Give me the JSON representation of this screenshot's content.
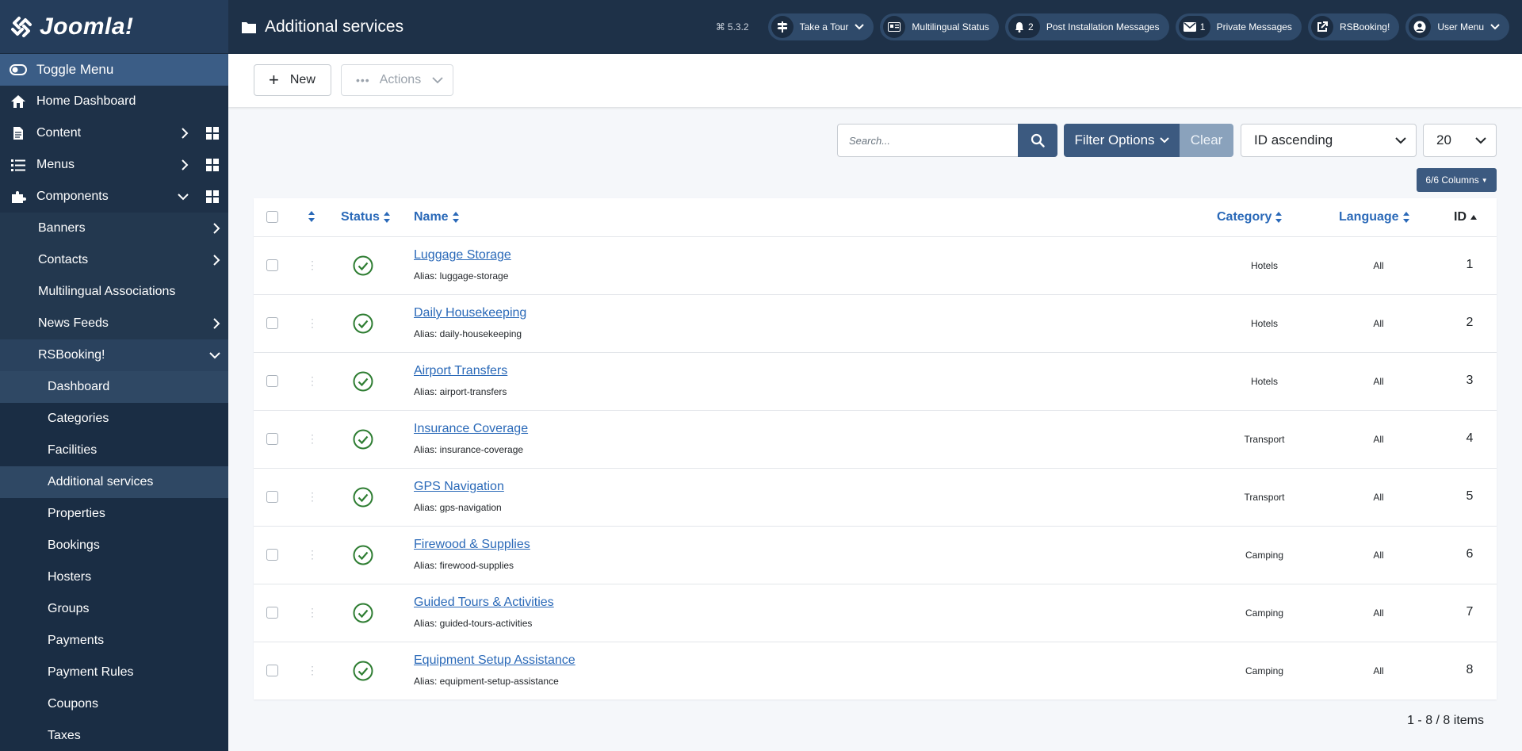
{
  "brand": {
    "logo_text": "Joomla!"
  },
  "sidebar": {
    "toggle": "Toggle Menu",
    "items": [
      {
        "label": "Home Dashboard",
        "icon": "home-icon"
      },
      {
        "label": "Content",
        "icon": "file-icon"
      },
      {
        "label": "Menus",
        "icon": "list-icon"
      },
      {
        "label": "Components",
        "icon": "puzzle-icon"
      }
    ],
    "components_sub": [
      {
        "label": "Banners"
      },
      {
        "label": "Contacts"
      },
      {
        "label": "Multilingual Associations"
      },
      {
        "label": "News Feeds"
      },
      {
        "label": "RSBooking!"
      }
    ],
    "rsbooking_sub": [
      {
        "label": "Dashboard"
      },
      {
        "label": "Categories"
      },
      {
        "label": "Facilities"
      },
      {
        "label": "Additional services"
      },
      {
        "label": "Properties"
      },
      {
        "label": "Bookings"
      },
      {
        "label": "Hosters"
      },
      {
        "label": "Groups"
      },
      {
        "label": "Payments"
      },
      {
        "label": "Payment Rules"
      },
      {
        "label": "Coupons"
      },
      {
        "label": "Taxes"
      }
    ]
  },
  "header": {
    "title": "Additional services",
    "version": "5.3.2",
    "take_tour": "Take a Tour",
    "multilingual": "Multilingual Status",
    "post_install_count": "2",
    "post_install": "Post Installation Messages",
    "private_count": "1",
    "private_messages": "Private Messages",
    "rsbooking": "RSBooking!",
    "user_menu": "User Menu"
  },
  "toolbar": {
    "new_label": "New",
    "actions_label": "Actions"
  },
  "filters": {
    "search_placeholder": "Search...",
    "filter_options": "Filter Options",
    "clear": "Clear",
    "sort_value": "ID ascending",
    "limit_value": "20",
    "columns": "6/6 Columns"
  },
  "table": {
    "headers": {
      "status": "Status",
      "name": "Name",
      "category": "Category",
      "language": "Language",
      "id": "ID"
    },
    "alias_prefix": "Alias: ",
    "rows": [
      {
        "name": "Luggage Storage",
        "alias": "Alias: luggage-storage",
        "category": "Hotels",
        "language": "All",
        "id": "1"
      },
      {
        "name": "Daily Housekeeping",
        "alias": "Alias: daily-housekeeping",
        "category": "Hotels",
        "language": "All",
        "id": "2"
      },
      {
        "name": "Airport Transfers",
        "alias": "Alias: airport-transfers",
        "category": "Hotels",
        "language": "All",
        "id": "3"
      },
      {
        "name": "Insurance Coverage",
        "alias": "Alias: insurance-coverage",
        "category": "Transport",
        "language": "All",
        "id": "4"
      },
      {
        "name": "GPS Navigation",
        "alias": "Alias: gps-navigation",
        "category": "Transport",
        "language": "All",
        "id": "5"
      },
      {
        "name": "Firewood & Supplies",
        "alias": "Alias: firewood-supplies",
        "category": "Camping",
        "language": "All",
        "id": "6"
      },
      {
        "name": "Guided Tours & Activities",
        "alias": "Alias: guided-tours-activities",
        "category": "Camping",
        "language": "All",
        "id": "7"
      },
      {
        "name": "Equipment Setup Assistance",
        "alias": "Alias: equipment-setup-assistance",
        "category": "Camping",
        "language": "All",
        "id": "8"
      }
    ]
  },
  "pagination": {
    "count": "1 - 8 / 8 items"
  },
  "colors": {
    "sidebar": "#1e3148",
    "accent": "#3c5a80",
    "link": "#2a69b8",
    "published": "#2e7d32"
  }
}
